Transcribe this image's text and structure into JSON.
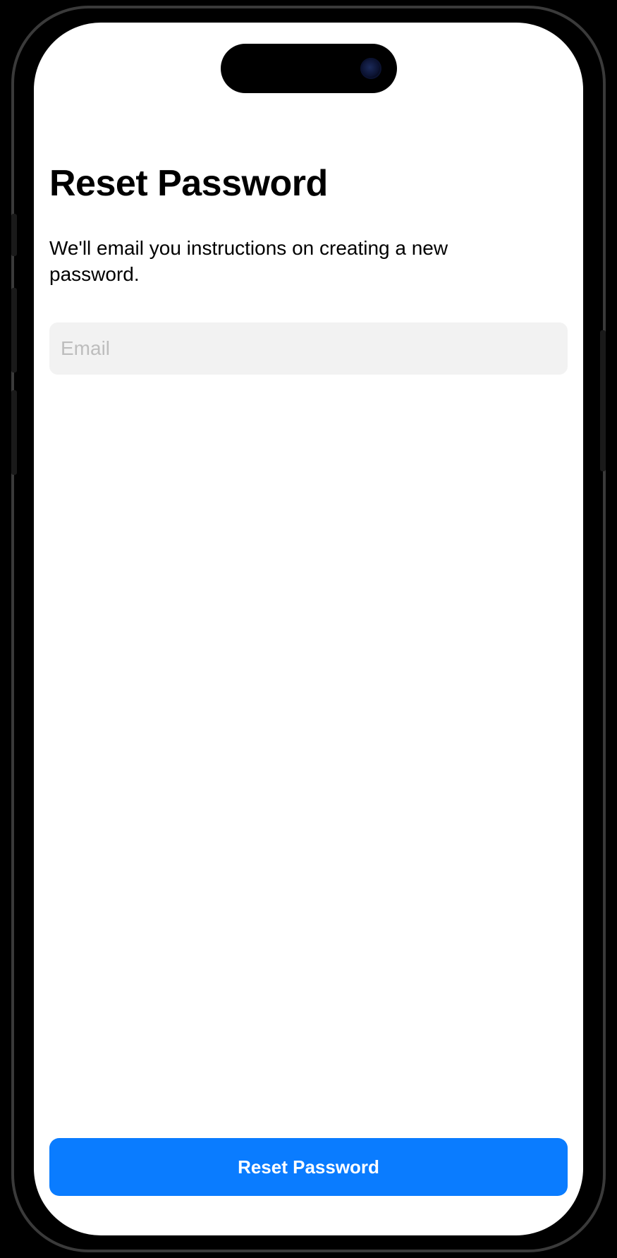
{
  "page": {
    "title": "Reset Password",
    "subtitle": "We'll email you instructions on creating a new password."
  },
  "form": {
    "email_placeholder": "Email",
    "email_value": ""
  },
  "actions": {
    "reset_button_label": "Reset Password"
  },
  "colors": {
    "accent": "#0a7cff",
    "input_bg": "#f2f2f2",
    "placeholder": "#bdbdbd"
  }
}
